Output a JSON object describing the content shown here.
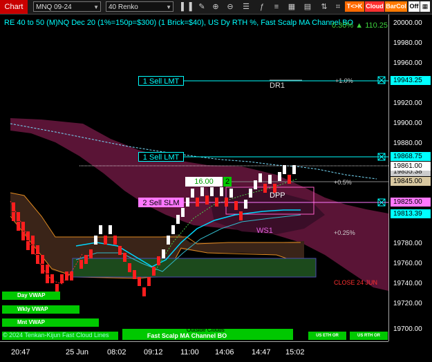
{
  "toolbar": {
    "title": "Chart",
    "instrument": "MNQ 09-24",
    "bar_type": "40 Renko",
    "toggles": {
      "tk": "T<>K",
      "cloud": "Cloud",
      "barcol": "BarCol",
      "off": "Off"
    }
  },
  "chart": {
    "title": "RE 40 to 50 (M)NQ Dec 20 (1%=150p=$300) (1 Brick=$40), US Dy RTH %, Fast Scalp MA Channel BO",
    "topright": "0.30% ▲ 110.25",
    "annotations": {
      "dr1": "DR1",
      "dpp": "DPP",
      "ws1": "WS1",
      "pct_1": "+1.0%",
      "pct_05": "+0.5%",
      "pct_025": "+0.25%",
      "close_label": "CLOSE 24 JUN",
      "box_value": "16.00",
      "box_count": "2",
      "outside_clouds": "Outside Clouds",
      "copyright": "© 2024 Tenkan-Kijun Fast Cloud Lines"
    },
    "orders": [
      {
        "label": "1 Sell LMT",
        "price": "19943.25"
      },
      {
        "label": "1 Sell LMT",
        "price": "19868.75"
      },
      {
        "label": "2 Sell SLM",
        "price": "19825.00"
      }
    ],
    "vwap_buttons": [
      "Day VWAP",
      "Wkly VWAP",
      "Mnt VWAP"
    ],
    "bottom_buttons": {
      "fast_scalp": "Fast Scalp MA Channel BO",
      "us_eth_or": "US ETH OR",
      "us_rth_or": "US RTH OR"
    }
  },
  "y_axis": {
    "ticks": [
      "20000.00",
      "19980.00",
      "19960.00",
      "19920.00",
      "19900.00",
      "19880.00",
      "19780.00",
      "19760.00",
      "19740.00",
      "19720.00",
      "19700.00"
    ],
    "price_tags": [
      "19943.25",
      "19868.75",
      "19855.38",
      "19861.00",
      "19845.00",
      "19825.00",
      "19813.39"
    ]
  },
  "x_axis": {
    "ticks": [
      "20:47",
      "25 Jun",
      "08:02",
      "09:12",
      "11:00",
      "14:06",
      "14:47",
      "15:02"
    ]
  },
  "chart_data": {
    "type": "renko",
    "instrument": "MNQ 09-24",
    "brick_size_usd": 40,
    "y_ticks": [
      20000,
      19980,
      19960,
      19920,
      19900,
      19880,
      19780,
      19760,
      19740,
      19720,
      19700
    ],
    "x_ticks": [
      "20:47",
      "25 Jun",
      "08:02",
      "09:12",
      "11:00",
      "14:06",
      "14:47",
      "15:02"
    ],
    "levels": {
      "sell_lmt_1": 19943.25,
      "sell_lmt_2": 19868.75,
      "sell_slm": 19825.0,
      "last": 19861.0
    }
  },
  "colors": {
    "up_brick": "#ffffff",
    "down_brick": "#ff1e1e",
    "cloud_red": "#5a1436",
    "cloud_green": "#1f5a1f",
    "accent_cyan": "#00ffff",
    "sell_order": "#ff78ff"
  }
}
